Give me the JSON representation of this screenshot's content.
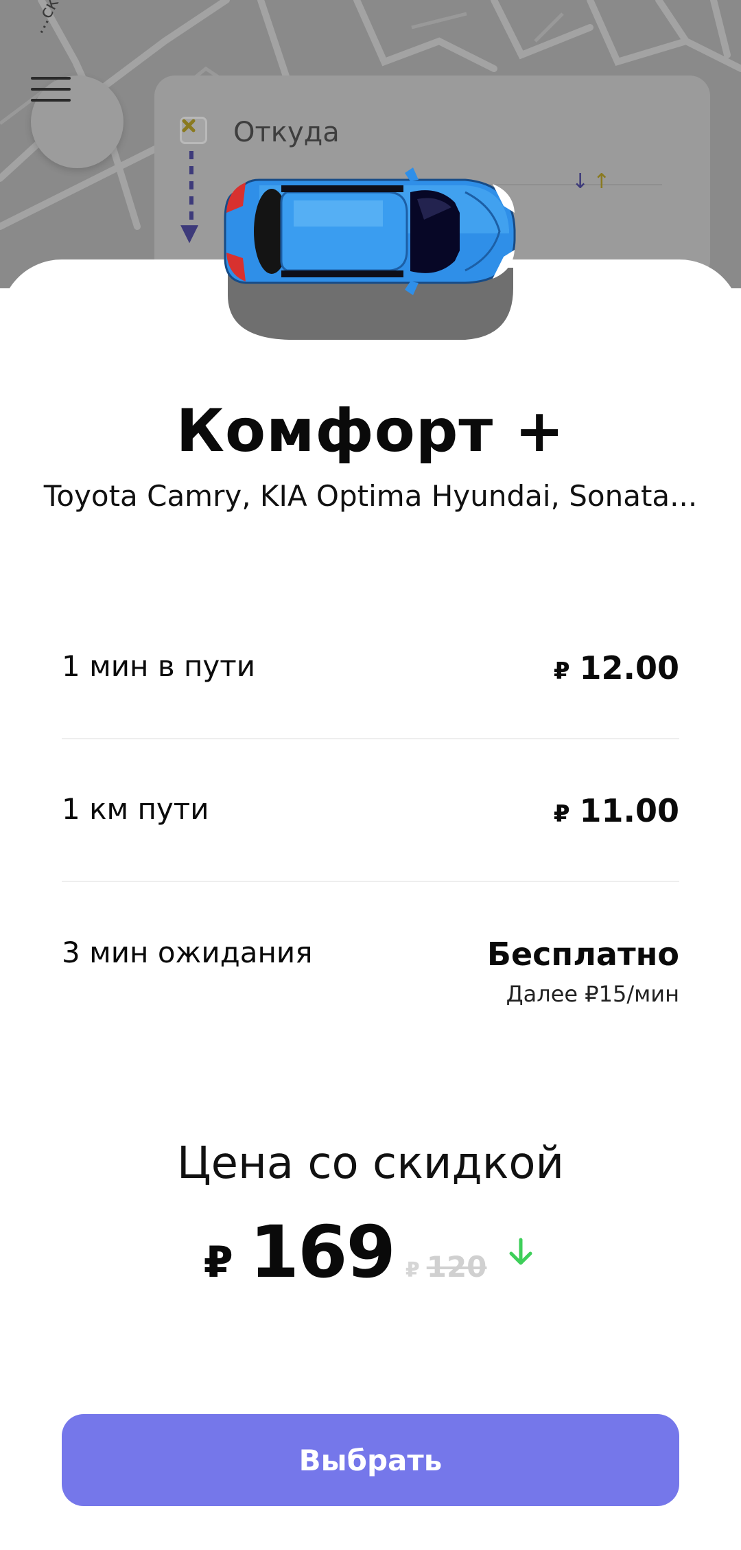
{
  "map": {
    "street_label": "...ской б-р"
  },
  "route": {
    "from_label": "Откуда"
  },
  "tariff": {
    "title": "Комфорт +",
    "cars": "Toyota Camry, KIA Optima Hyundai, Sonata..."
  },
  "rows": [
    {
      "label": "1 мин в пути",
      "currency": "₽",
      "value": "12.00"
    },
    {
      "label": "1 км пути",
      "currency": "₽",
      "value": "11.00"
    },
    {
      "label": "3 мин ожидания",
      "value": "Бесплатно",
      "sub": "Далее ₽15/мин"
    }
  ],
  "price": {
    "label": "Цена со скидкой",
    "currency": "₽",
    "amount": "169",
    "old_currency": "₽",
    "old_amount": "120"
  },
  "action": {
    "select_label": "Выбрать"
  },
  "colors": {
    "accent": "#7577ea",
    "discount_arrow": "#3ecf5a",
    "car_body": "#2f8fe8"
  }
}
